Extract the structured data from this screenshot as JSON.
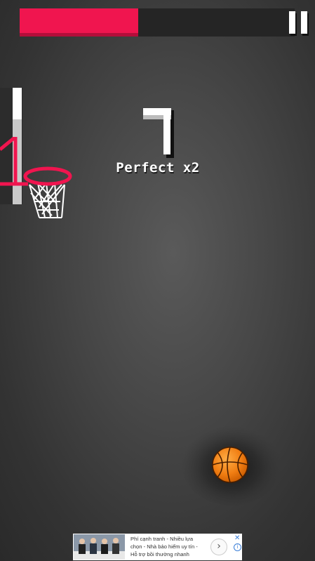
{
  "hud": {
    "timer_progress_percent": 43,
    "timer_color": "#f0154f",
    "pause_icon": "pause-icon"
  },
  "game": {
    "score": "7",
    "perfect_text": "Perfect x2",
    "hoop_color": "#f0154f",
    "ball_icon": "basketball-icon"
  },
  "ad": {
    "text_lines": [
      "Phí cạnh tranh - Nhiều lựa",
      "chọn - Nhà bảo hiểm uy tín -",
      "Hỗ trợ bồi thường nhanh"
    ],
    "close_label": "✕",
    "info_label": "i",
    "arrow_label": "›"
  }
}
